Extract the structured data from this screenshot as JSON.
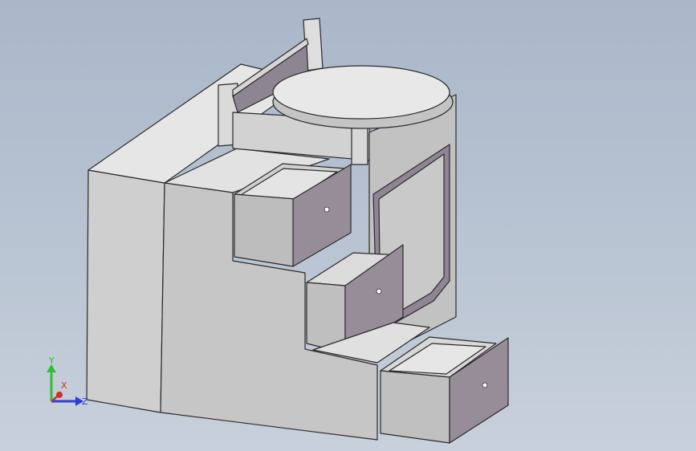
{
  "viewport": {
    "background_top": "#a9b7c9",
    "background_bottom": "#c8d0db"
  },
  "model": {
    "colors": {
      "light_face": "#dcdcdc",
      "front_face": "#c9c9c9",
      "drawer_face": "#978d99",
      "drawer_inner": "#c4c4c4",
      "edge": "#2a2a2a"
    }
  },
  "triad": {
    "y_label": "Y",
    "x_label": "X",
    "z_label": "Z",
    "y_color": "#2fbf2f",
    "x_color": "#d0302b",
    "z_color": "#2b3fd0"
  }
}
